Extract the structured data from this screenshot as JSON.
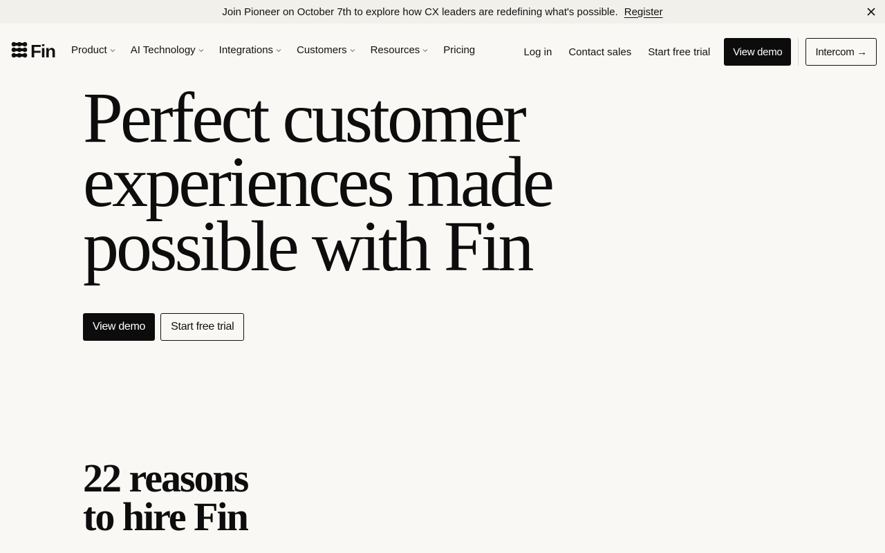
{
  "announcement": {
    "message": "Join Pioneer on October 7th to explore how CX leaders are redefining what's possible.",
    "link": "Register",
    "close_icon": "close-icon"
  },
  "nav": {
    "logo_text": "Fin",
    "logo_icon": "fin-logo-icon",
    "menu": [
      {
        "label": "Product",
        "has_dropdown": true
      },
      {
        "label": "AI Technology",
        "has_dropdown": true
      },
      {
        "label": "Integrations",
        "has_dropdown": true
      },
      {
        "label": "Customers",
        "has_dropdown": true
      },
      {
        "label": "Resources",
        "has_dropdown": true
      },
      {
        "label": "Pricing",
        "has_dropdown": false
      }
    ],
    "login": "Log in",
    "contact": "Contact sales",
    "trial": "Start free trial",
    "demo": "View demo",
    "intercom": "Intercom →"
  },
  "hero": {
    "title_lines": [
      "Perfect customer",
      "experiences made",
      "possible with Fin"
    ],
    "primary_cta": "View demo",
    "secondary_cta": "Start free trial"
  },
  "reasons": {
    "lines": [
      "22 reasons",
      "to hire Fin"
    ]
  },
  "colors": {
    "background": "#f9f8f4",
    "announcement_bg": "#f1f0eb",
    "primary": "#0c0c0c",
    "text": "#111111"
  }
}
